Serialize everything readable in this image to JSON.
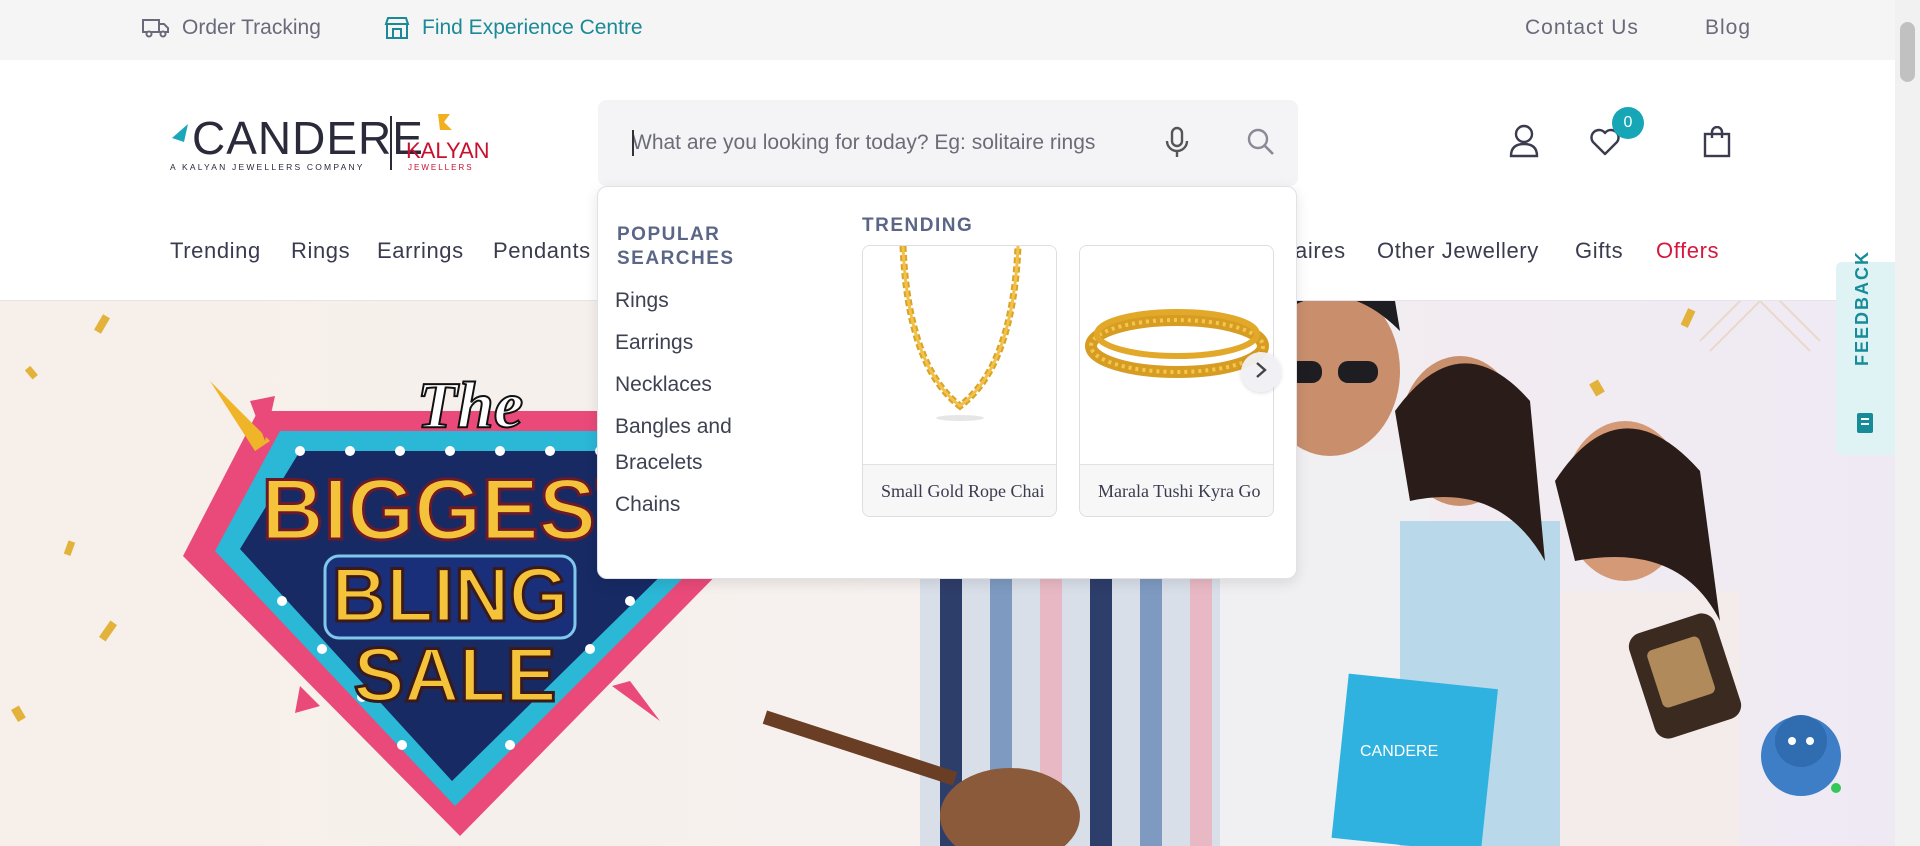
{
  "topbar": {
    "order_tracking": "Order Tracking",
    "experience_centre": "Find Experience Centre",
    "contact_us": "Contact Us",
    "blog": "Blog"
  },
  "logo": {
    "brand": "CANDERE",
    "tagline": "A KALYAN JEWELLERS COMPANY",
    "partner": "KALYAN",
    "partner_sub": "JEWELLERS"
  },
  "search": {
    "placeholder": "What are you looking for today? Eg: solitaire rings",
    "value": ""
  },
  "header": {
    "wishlist_count": "0"
  },
  "nav": {
    "items": [
      "Trending",
      "Rings",
      "Earrings",
      "Pendants",
      "aires",
      "Other Jewellery",
      "Gifts",
      "Offers"
    ]
  },
  "dropdown": {
    "popular_heading": "POPULAR SEARCHES",
    "popular_line1": "POPULAR",
    "popular_line2": "SEARCHES",
    "popular": [
      "Rings",
      "Earrings",
      "Necklaces",
      "Bangles and Bracelets",
      "Chains"
    ],
    "trending_heading": "TRENDING",
    "trending": [
      {
        "name": "Small Gold Rope Chai"
      },
      {
        "name": "Marala Tushi Kyra Go"
      }
    ]
  },
  "banner": {
    "line1": "The",
    "line2": "BIGGEST",
    "line3": "BLING",
    "line4": "SALE",
    "bag_brand": "CANDERE"
  },
  "feedback": {
    "label": "FEEDBACK"
  },
  "colors": {
    "accent": "#16a6b6",
    "offers": "#d6183f",
    "teal_link": "#1a8a96"
  }
}
